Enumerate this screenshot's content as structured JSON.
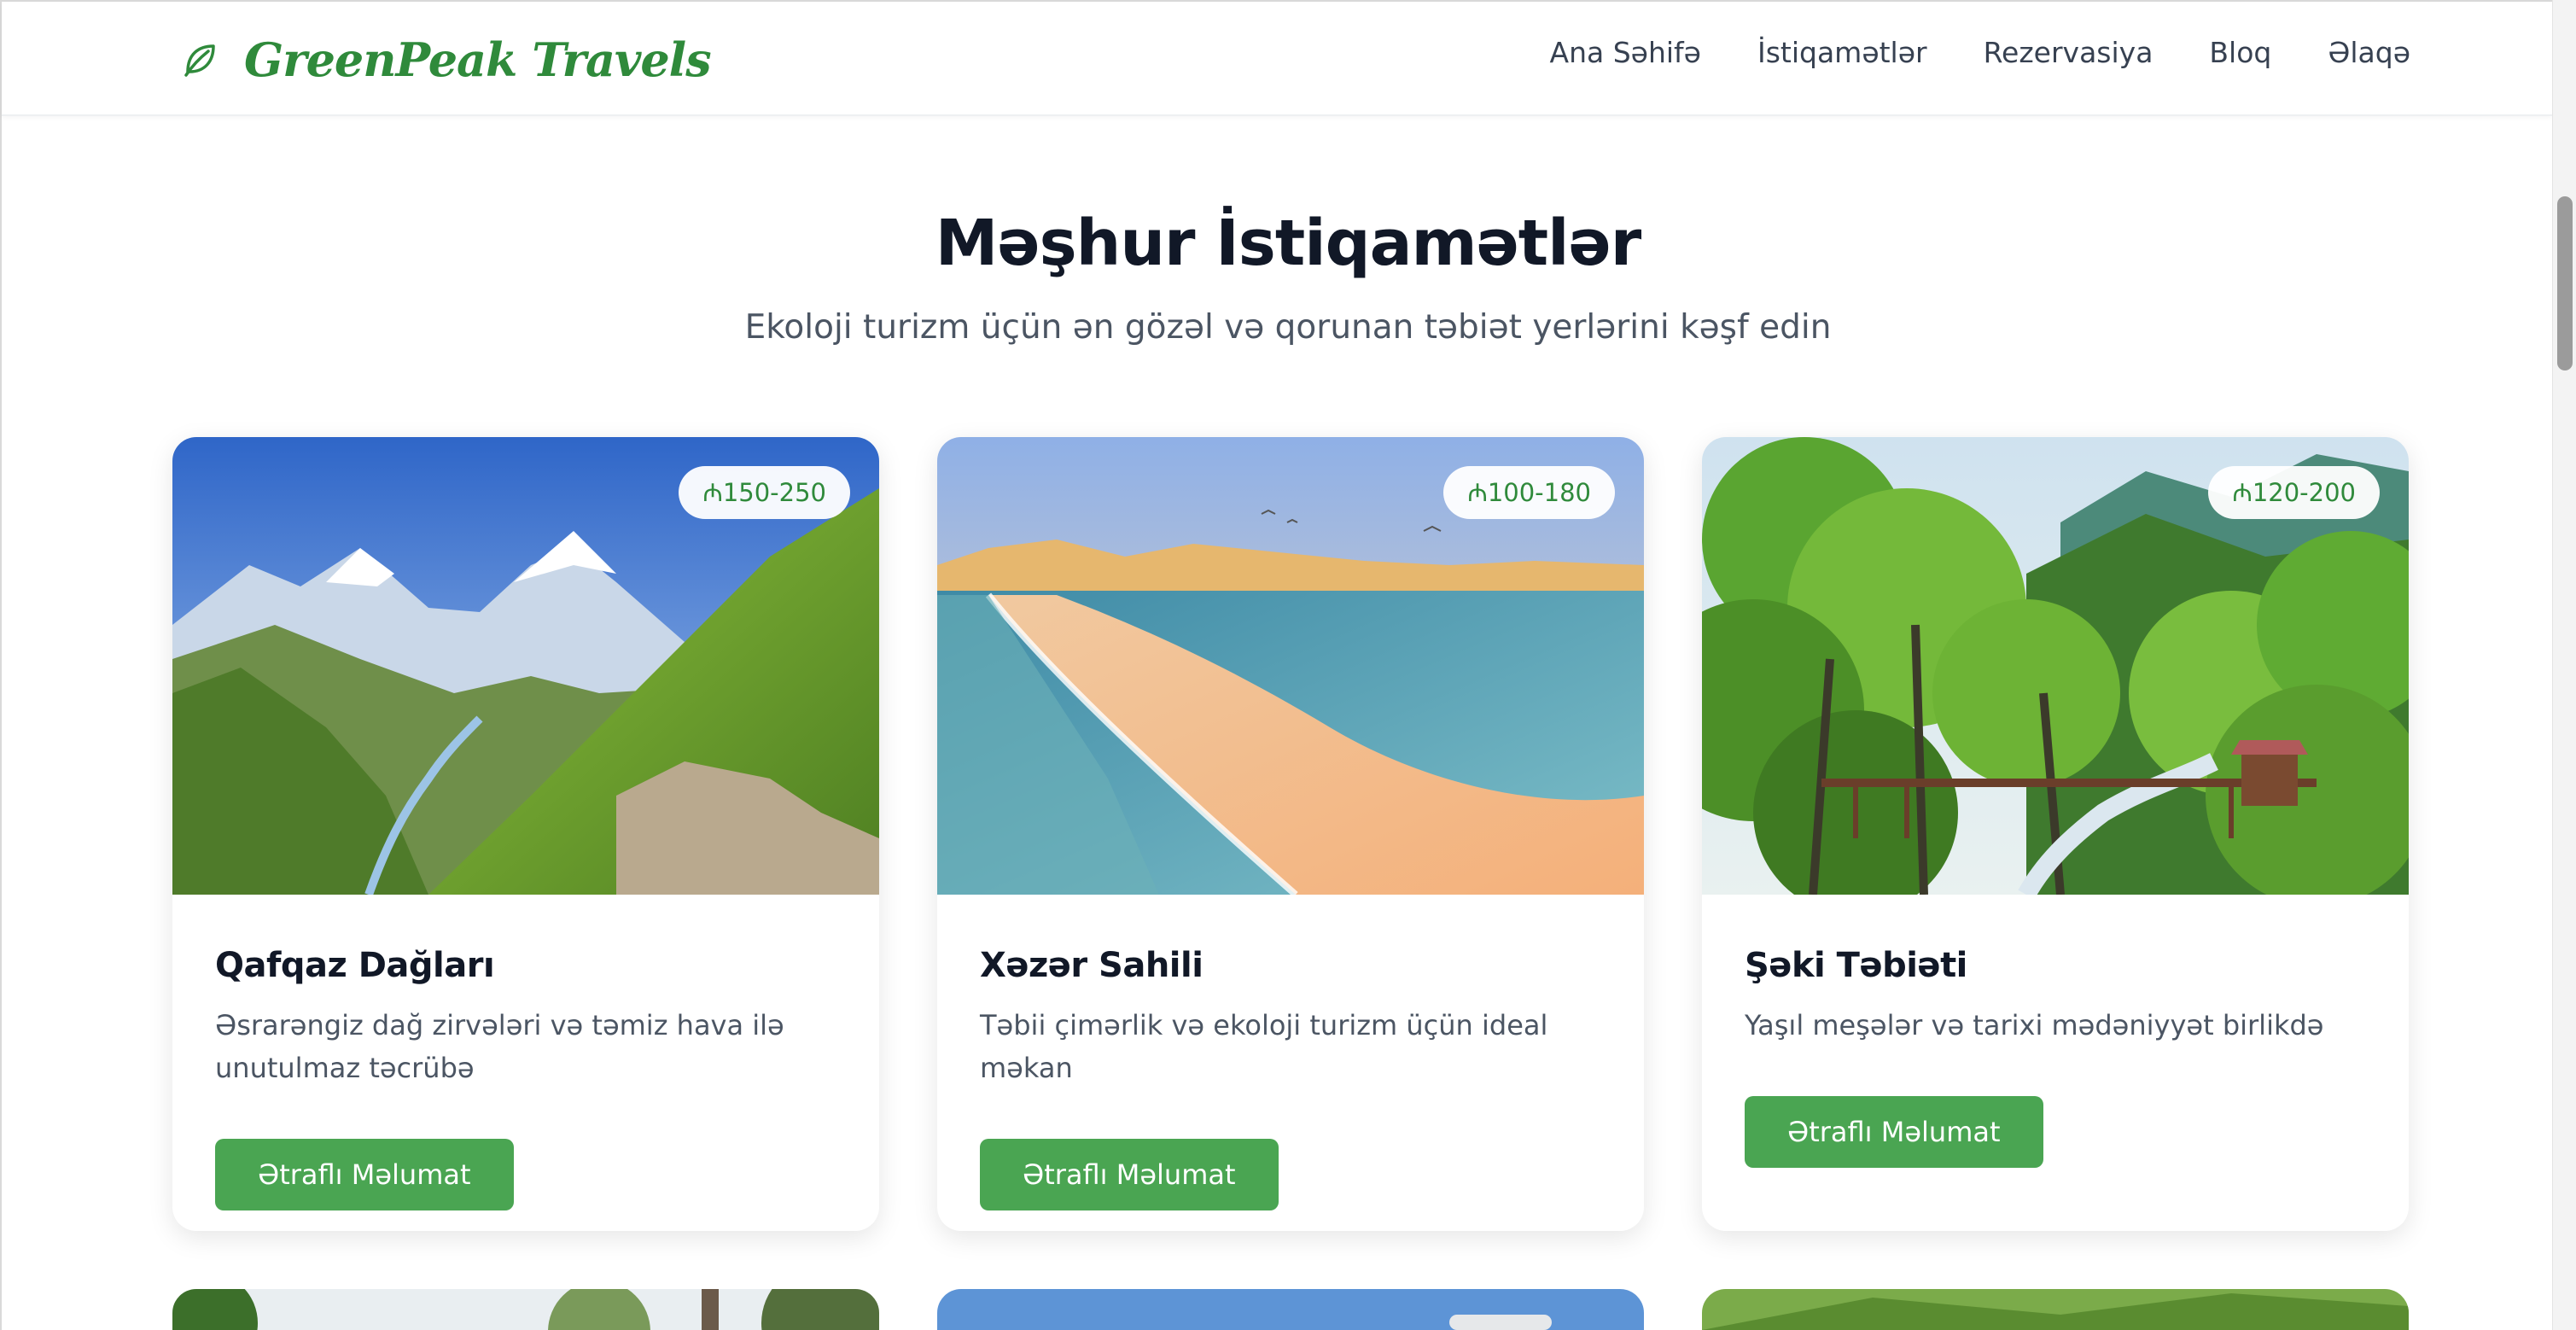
{
  "brand": {
    "name": "GreenPeak Travels",
    "icon": "leaf-icon",
    "color": "#2f8a3b"
  },
  "nav": {
    "items": [
      "Ana Səhifə",
      "İstiqamətlər",
      "Rezervasiya",
      "Bloq",
      "Əlaqə"
    ]
  },
  "section": {
    "title": "Məşhur İstiqamətlər",
    "subtitle": "Ekoloji turizm üçün ən gözəl və qorunan təbiət yerlərini kəşf edin"
  },
  "cards": [
    {
      "title": "Qafqaz Dağları",
      "price": "₼150-250",
      "description": "Əsrarəngiz dağ zirvələri və təmiz hava ilə unutulmaz təcrübə",
      "button": "Ətraflı Məlumat",
      "image": "mountains-image"
    },
    {
      "title": "Xəzər Sahili",
      "price": "₼100-180",
      "description": "Təbii çimərlik və ekoloji turizm üçün ideal məkan",
      "button": "Ətraflı Məlumat",
      "image": "beach-image"
    },
    {
      "title": "Şəki Təbiəti",
      "price": "₼120-200",
      "description": "Yaşıl meşələr və tarixi mədəniyyət birlikdə",
      "button": "Ətraflı Məlumat",
      "image": "forest-image"
    }
  ],
  "colors": {
    "accent": "#4aa552",
    "heading": "#111827",
    "muted": "#4b5563"
  }
}
